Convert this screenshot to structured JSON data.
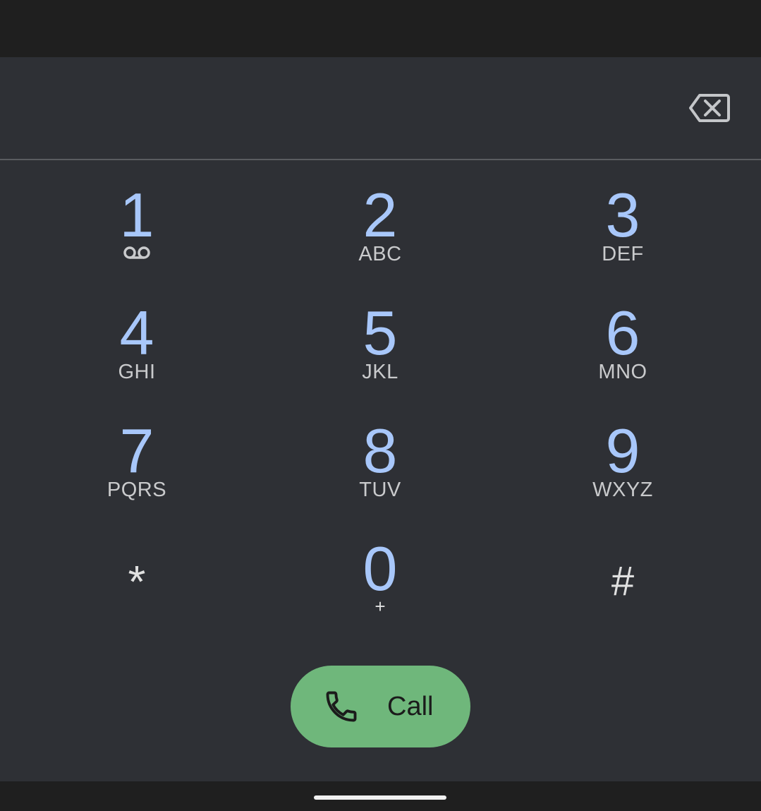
{
  "dialer": {
    "number_value": "",
    "keys": [
      {
        "digit": "1",
        "letters": "",
        "icon": "voicemail-icon"
      },
      {
        "digit": "2",
        "letters": "ABC"
      },
      {
        "digit": "3",
        "letters": "DEF"
      },
      {
        "digit": "4",
        "letters": "GHI"
      },
      {
        "digit": "5",
        "letters": "JKL"
      },
      {
        "digit": "6",
        "letters": "MNO"
      },
      {
        "digit": "7",
        "letters": "PQRS"
      },
      {
        "digit": "8",
        "letters": "TUV"
      },
      {
        "digit": "9",
        "letters": "WXYZ"
      },
      {
        "digit": "*",
        "letters": ""
      },
      {
        "digit": "0",
        "letters": "+"
      },
      {
        "digit": "#",
        "letters": ""
      }
    ],
    "call_label": "Call",
    "backspace_icon": "backspace-icon",
    "call_icon": "phone-icon"
  },
  "colors": {
    "background": "#2e3035",
    "digit": "#a8c7fa",
    "call_button": "#6fb77b"
  }
}
